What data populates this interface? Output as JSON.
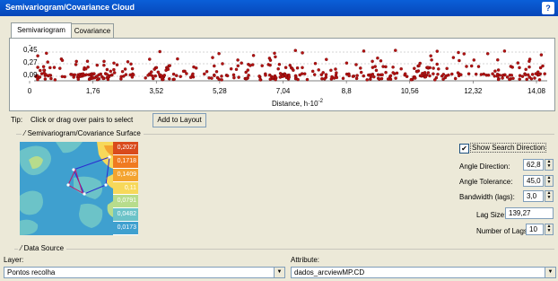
{
  "window": {
    "title": "Semivariogram/Covariance Cloud",
    "help": "?"
  },
  "tabs": [
    {
      "label": "Semivariogram"
    },
    {
      "label": "Covariance"
    }
  ],
  "plot": {
    "y_ticks": [
      "0,45",
      "0,27",
      "0,09"
    ],
    "y_top_tick": "-",
    "x_ticks": [
      "0",
      "1,76",
      "3,52",
      "5,28",
      "7,04",
      "8,8",
      "10,56",
      "12,32",
      "14,08"
    ],
    "x_label_main": "Distance, h·10",
    "x_label_exp": "-2",
    "point_color": "#b31212"
  },
  "tip": {
    "label": "Tip:",
    "text": "Click or drag over pairs to select",
    "add_layout": "Add to Layout"
  },
  "surface": {
    "group_title": "Semivariogram/Covariance Surface",
    "legend": [
      {
        "value": "0,2027",
        "color": "#d94a1c"
      },
      {
        "value": "0,1718",
        "color": "#f07a20"
      },
      {
        "value": "0,1409",
        "color": "#f4a430"
      },
      {
        "value": "0,11",
        "color": "#f7d85a"
      },
      {
        "value": "0,0791",
        "color": "#b7dc8c"
      },
      {
        "value": "0,0482",
        "color": "#6cc3c8"
      },
      {
        "value": "0,0173",
        "color": "#3fa0cf"
      }
    ]
  },
  "controls": {
    "show_search_direction": "Show Search Direction",
    "show_search_checked": true,
    "angle_direction_label": "Angle Direction:",
    "angle_direction_value": "62,8",
    "angle_tolerance_label": "Angle Tolerance:",
    "angle_tolerance_value": "45,0",
    "bandwidth_label": "Bandwidth (lags):",
    "bandwidth_value": "3,0",
    "lag_size_label": "Lag Size:",
    "lag_size_value": "139,27",
    "num_lags_label": "Number of Lags:",
    "num_lags_value": "10"
  },
  "data_source": {
    "group_title": "Data Source",
    "layer_label": "Layer:",
    "layer_value": "Pontos recolha",
    "attribute_label": "Attribute:",
    "attribute_value": "dados_arcviewMP.CD"
  }
}
